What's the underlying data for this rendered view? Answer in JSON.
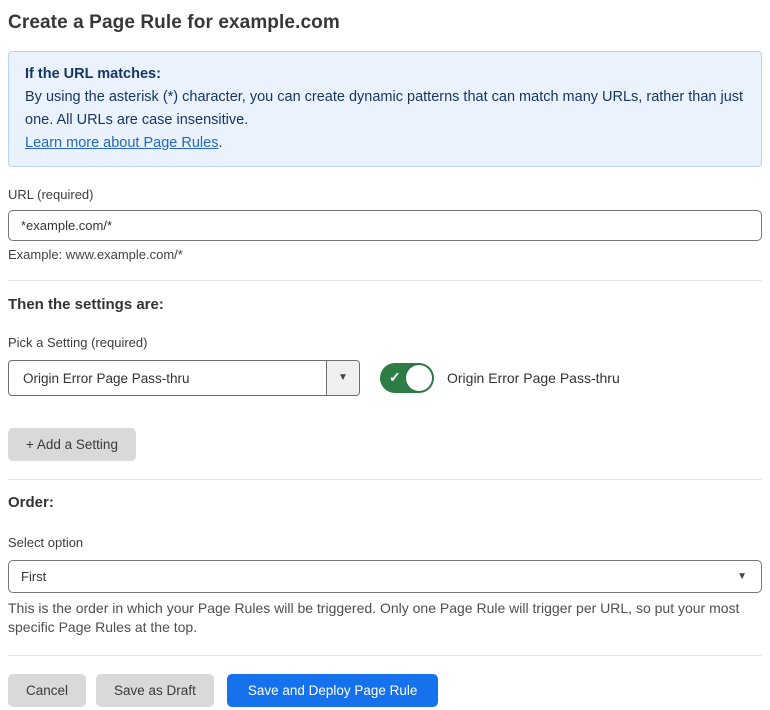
{
  "page": {
    "title": "Create a Page Rule for example.com"
  },
  "info_box": {
    "heading": "If the URL matches:",
    "body": "By using the asterisk (*) character, you can create dynamic patterns that can match many URLs, rather than just one. All URLs are case insensitive.",
    "link_label": "Learn more about Page Rules",
    "link_suffix": "."
  },
  "url_section": {
    "label": "URL (required)",
    "input_value": "*example.com/*",
    "example": "Example: www.example.com/*"
  },
  "settings_section": {
    "heading": "Then the settings are:",
    "picker_label": "Pick a Setting (required)",
    "selected_setting": "Origin Error Page Pass-thru",
    "caret_icon": "▼",
    "toggle_state": "on",
    "toggle_check": "✓",
    "toggle_label": "Origin Error Page Pass-thru",
    "add_button_label": "+ Add a Setting"
  },
  "order_section": {
    "heading": "Order:",
    "select_label": "Select option",
    "selected_option": "First",
    "caret_icon": "▼",
    "help_text": "This is the order in which your Page Rules will be triggered. Only one Page Rule will trigger per URL, so put your most specific Page Rules at the top."
  },
  "footer": {
    "cancel_label": "Cancel",
    "save_draft_label": "Save as Draft",
    "save_deploy_label": "Save and Deploy Page Rule"
  },
  "colors": {
    "info_background": "#e9f2fd",
    "info_border": "#b5d5f2",
    "info_text": "#16355f",
    "link": "#2667c0",
    "toggle_on_green": "#2e7d46",
    "primary_button_blue": "#1672ec",
    "secondary_button_gray": "#d9d9d9",
    "divider": "#e3e3e3"
  }
}
